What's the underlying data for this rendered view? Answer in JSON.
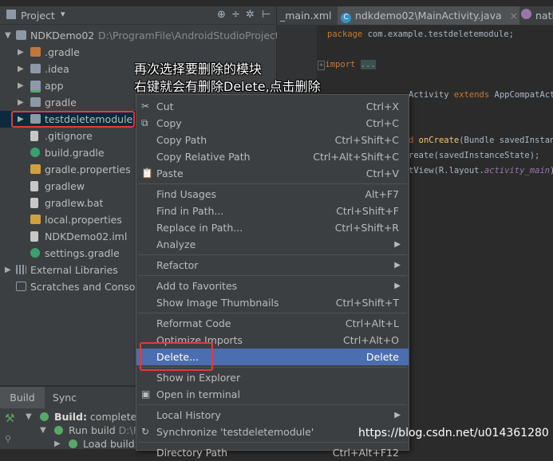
{
  "project_panel": {
    "title": "Project",
    "dropdown": "▾",
    "tools": [
      "⊕",
      "÷",
      "✲",
      "⊢"
    ]
  },
  "tree": [
    {
      "label": "NDKDemo02",
      "extra": "D:\\ProgramFile\\AndroidStudioProjects",
      "icon": "folder",
      "indent": 0,
      "arrow": "▼"
    },
    {
      "label": ".gradle",
      "icon": "folder-orange",
      "indent": 1,
      "arrow": "▶"
    },
    {
      "label": ".idea",
      "icon": "folder",
      "indent": 1,
      "arrow": "▶"
    },
    {
      "label": "app",
      "icon": "folder-module",
      "indent": 1,
      "arrow": "▶"
    },
    {
      "label": "gradle",
      "icon": "folder",
      "indent": 1,
      "arrow": "▶"
    },
    {
      "label": "testdeletemodule",
      "icon": "folder",
      "indent": 1,
      "arrow": "▶",
      "selected": true
    },
    {
      "label": ".gitignore",
      "icon": "file",
      "indent": 2
    },
    {
      "label": "build.gradle",
      "icon": "gradle",
      "indent": 2
    },
    {
      "label": "gradle.properties",
      "icon": "props",
      "indent": 2
    },
    {
      "label": "gradlew",
      "icon": "file",
      "indent": 2
    },
    {
      "label": "gradlew.bat",
      "icon": "file",
      "indent": 2
    },
    {
      "label": "local.properties",
      "icon": "props",
      "indent": 2
    },
    {
      "label": "NDKDemo02.iml",
      "icon": "file",
      "indent": 2
    },
    {
      "label": "settings.gradle",
      "icon": "gradle",
      "indent": 2
    },
    {
      "label": "External Libraries",
      "icon": "libraries",
      "indent": 0,
      "arrow": "▶"
    },
    {
      "label": "Scratches and Consoles",
      "icon": "scratches",
      "indent": 0
    }
  ],
  "editor_tabs": [
    {
      "label": "_main.xml",
      "close": "×"
    },
    {
      "label": "ndkdemo02\\MainActivity.java",
      "icon": "C",
      "close": "×",
      "active": true
    },
    {
      "label": "nati"
    }
  ],
  "code": {
    "line1_kw": "package",
    "line1_rest": " com.example.testdeletemodule;",
    "import_kw": "import",
    "import_fold": "...",
    "class_rest": "Activity ",
    "class_kw": "extends",
    "class_parent": " AppCompatActi",
    "method_prefix": "d ",
    "method_name": "onCreate",
    "method_rest": "(Bundle savedInstanc",
    "super_line": "reate(savedInstanceState);",
    "setview_line": "tView(R.layout.",
    "setview_field": "activity_main",
    "setview_end": ");"
  },
  "annotation": {
    "line1": "再次选择要删除的模块",
    "line2": "右键就会有删除Delete,点击删除"
  },
  "context_menu": [
    {
      "label": "Cut",
      "shortcut": "Ctrl+X",
      "icon": "✂"
    },
    {
      "label": "Copy",
      "shortcut": "Ctrl+C",
      "icon": "⧉"
    },
    {
      "label": "Copy Path",
      "shortcut": "Ctrl+Shift+C"
    },
    {
      "label": "Copy Relative Path",
      "shortcut": "Ctrl+Alt+Shift+C"
    },
    {
      "label": "Paste",
      "shortcut": "Ctrl+V",
      "icon": "📋"
    },
    {
      "sep": true
    },
    {
      "label": "Find Usages",
      "shortcut": "Alt+F7"
    },
    {
      "label": "Find in Path...",
      "shortcut": "Ctrl+Shift+F"
    },
    {
      "label": "Replace in Path...",
      "shortcut": "Ctrl+Shift+R"
    },
    {
      "label": "Analyze",
      "submenu": "▶"
    },
    {
      "sep": true
    },
    {
      "label": "Refactor",
      "submenu": "▶"
    },
    {
      "sep": true
    },
    {
      "label": "Add to Favorites",
      "submenu": "▶"
    },
    {
      "label": "Show Image Thumbnails",
      "shortcut": "Ctrl+Shift+T"
    },
    {
      "sep": true
    },
    {
      "label": "Reformat Code",
      "shortcut": "Ctrl+Alt+L"
    },
    {
      "label": "Optimize Imports",
      "shortcut": "Ctrl+Alt+O"
    },
    {
      "label": "Delete...",
      "shortcut": "Delete",
      "highlighted": true
    },
    {
      "sep": true
    },
    {
      "label": "Show in Explorer"
    },
    {
      "label": "Open in terminal",
      "icon": "▣"
    },
    {
      "sep": true
    },
    {
      "label": "Local History",
      "submenu": "▶"
    },
    {
      "label": "Synchronize 'testdeletemodule'",
      "icon": "↻"
    },
    {
      "sep": true
    },
    {
      "label": "Directory Path",
      "shortcut": "Ctrl+Alt+F12"
    }
  ],
  "build_panel": {
    "tabs": [
      "Build",
      "Sync"
    ],
    "items": [
      {
        "prefix": "Build:",
        "text": " completed"
      },
      {
        "prefix": "",
        "text": "Run build",
        "extra": " D:\\F"
      },
      {
        "prefix": "",
        "text": "Load build"
      }
    ]
  },
  "watermark": "https://blog.csdn.net/u014361280"
}
